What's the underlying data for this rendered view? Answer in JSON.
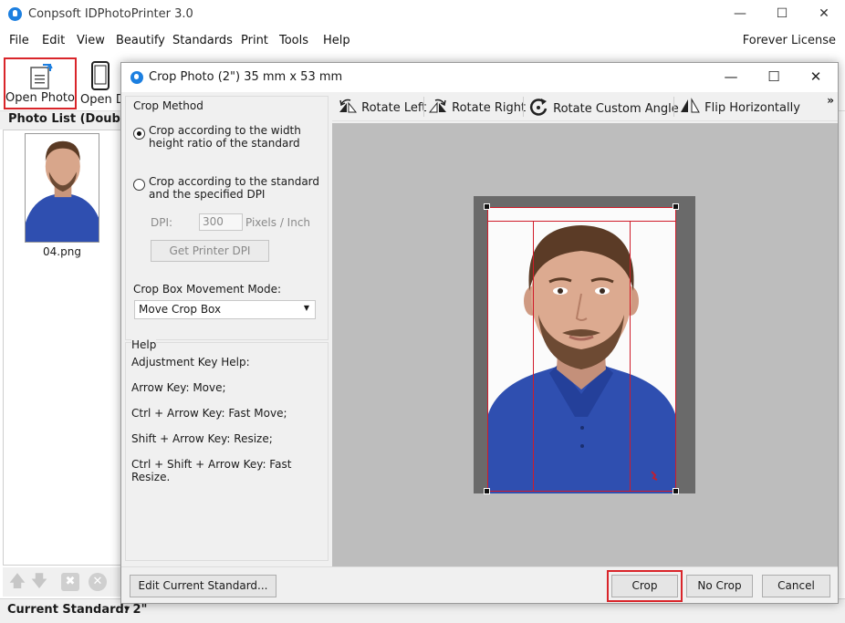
{
  "app": {
    "title": "Conpsoft IDPhotoPrinter 3.0",
    "license": "Forever License"
  },
  "menu": [
    "File",
    "Edit",
    "View",
    "Beautify",
    "Standards",
    "Print",
    "Tools",
    "Help"
  ],
  "toolbar": {
    "open_photo": "Open Photo",
    "open_device": "Open D"
  },
  "photo_list": {
    "header": "Photo List (Double c",
    "items": [
      {
        "name": "04.png"
      }
    ]
  },
  "status": {
    "current_standard": "Current Standard: 2\""
  },
  "dialog": {
    "title": "Crop Photo (2\") 35 mm x 53 mm",
    "crop_method": {
      "title": "Crop Method",
      "option_ratio": "Crop according to the width height ratio of the standard",
      "option_ratio_line1": "Crop according to the width",
      "option_ratio_line2": "height ratio of the standard",
      "option_dpi_line1": "Crop according to the standard",
      "option_dpi_line2": "and the specified DPI",
      "selected": "ratio",
      "dpi_label": "DPI:",
      "dpi_value": "300",
      "dpi_unit": "Pixels / Inch",
      "get_printer_dpi": "Get Printer DPI",
      "movement_label": "Crop Box Movement Mode:",
      "movement_value": "Move Crop Box"
    },
    "help": {
      "title": "Help",
      "lines": [
        "Adjustment Key Help:",
        "Arrow Key: Move;",
        "Ctrl + Arrow Key: Fast Move;",
        "Shift + Arrow Key: Resize;",
        "Ctrl + Shift + Arrow Key: Fast Resize."
      ]
    },
    "tools": {
      "rotate_left": "Rotate Left",
      "rotate_right": "Rotate Right",
      "rotate_custom": "Rotate Custom Angle",
      "flip_horizontal": "Flip Horizontally",
      "more": "»"
    },
    "buttons": {
      "edit_standard": "Edit Current Standard...",
      "crop": "Crop",
      "no_crop": "No Crop",
      "cancel": "Cancel"
    }
  },
  "colors": {
    "accent": "#1c7fe0",
    "highlight_red": "#d9252a",
    "shirt_blue": "#2f4fb0"
  },
  "icons": [
    "app-icon",
    "minimize-icon",
    "maximize-icon",
    "close-icon",
    "open-photo-icon",
    "phone-icon",
    "rotate-left-icon",
    "rotate-right-icon",
    "rotate-custom-icon",
    "flip-horizontal-icon"
  ]
}
